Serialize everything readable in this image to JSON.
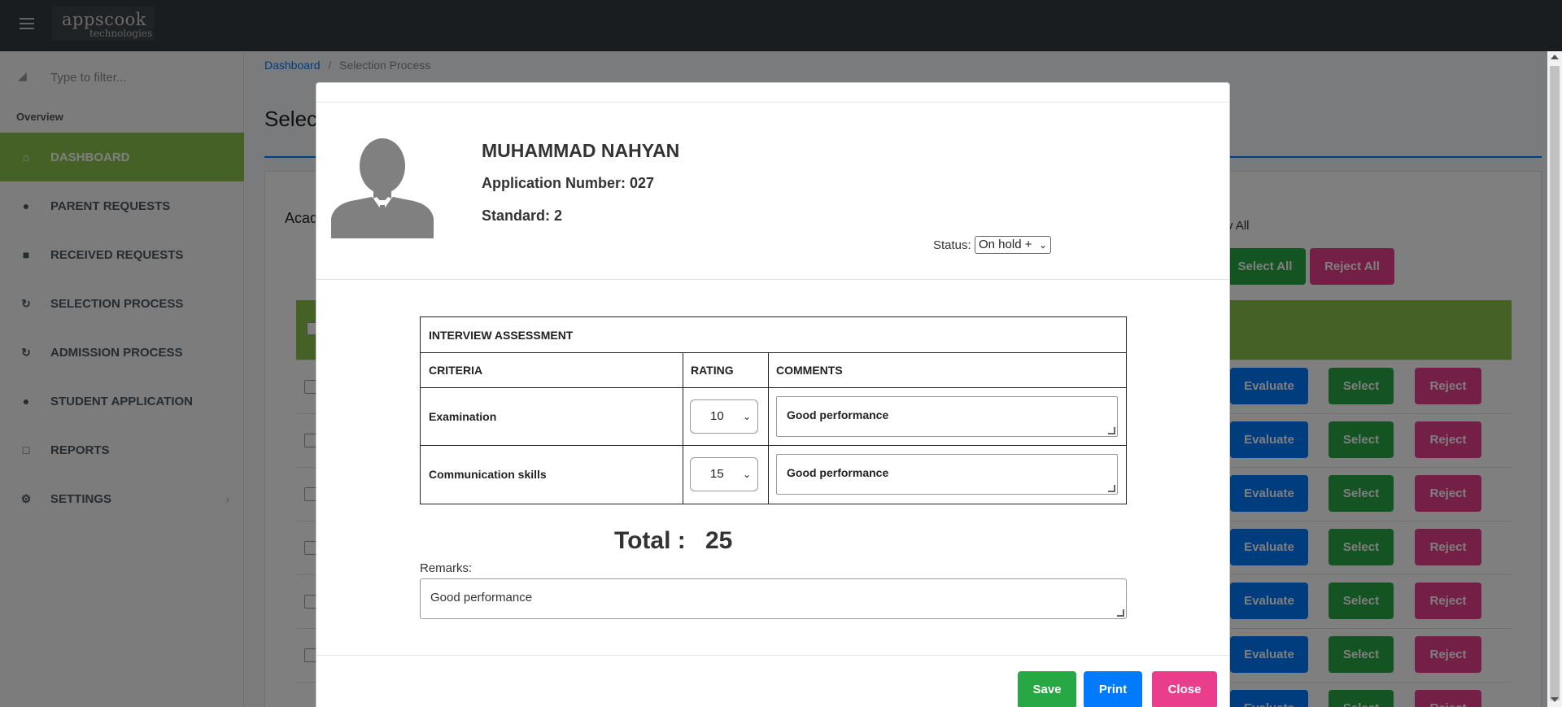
{
  "app": {
    "logo_main": "appscook",
    "logo_sub": "technologies"
  },
  "sidebar": {
    "filter_placeholder": "Type to filter...",
    "section_label": "Overview",
    "items": [
      {
        "label": "DASHBOARD",
        "icon": "home-icon",
        "active": true
      },
      {
        "label": "PARENT REQUESTS",
        "icon": "users-icon"
      },
      {
        "label": "RECEIVED REQUESTS",
        "icon": "briefcase-icon"
      },
      {
        "label": "SELECTION PROCESS",
        "icon": "refresh-icon"
      },
      {
        "label": "ADMISSION PROCESS",
        "icon": "refresh-icon"
      },
      {
        "label": "STUDENT APPLICATION",
        "icon": "users-icon"
      },
      {
        "label": "REPORTS",
        "icon": "file-icon"
      },
      {
        "label": "SETTINGS",
        "icon": "gears-icon"
      }
    ]
  },
  "breadcrumb": {
    "home": "Dashboard",
    "current": "Selection Process"
  },
  "page": {
    "title": "Select",
    "academic_label": "Acad",
    "view_all_label": "v All",
    "select_all": "Select All",
    "reject_all": "Reject All"
  },
  "rows": {
    "evaluate": "Evaluate",
    "select": "Select",
    "reject": "Reject"
  },
  "modal": {
    "student_name": "MUHAMMAD NAHYAN",
    "application_number": "Application Number: 027",
    "standard": "Standard: 2",
    "status_label": "Status:",
    "status_value": "On hold +",
    "assessment": {
      "title": "INTERVIEW ASSESSMENT",
      "col_criteria": "CRITERIA",
      "col_rating": "RATING",
      "col_comments": "COMMENTS",
      "rows": [
        {
          "criteria": "Examination",
          "rating": "10",
          "comment": "Good performance"
        },
        {
          "criteria": "Communication skills",
          "rating": "15",
          "comment": "Good performance"
        }
      ]
    },
    "total_label": "Total :",
    "total_value": "25",
    "remarks_label": "Remarks:",
    "remarks_value": "Good performance",
    "buttons": {
      "save": "Save",
      "print": "Print",
      "close": "Close"
    }
  },
  "colors": {
    "topbar": "#343a40",
    "active_nav": "#8bc34a",
    "primary": "#007bff",
    "success": "#28a745",
    "danger": "#e83e8c"
  }
}
